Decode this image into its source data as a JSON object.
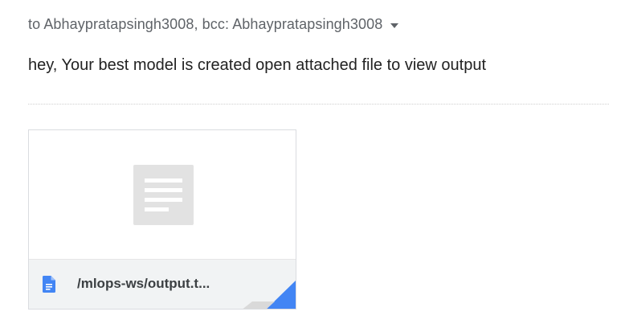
{
  "message": {
    "recipients_line": "to Abhaypratapsingh3008, bcc: Abhaypratapsingh3008",
    "details_toggle_icon": "caret-down-icon",
    "body": "hey, Your best model is created open attached file to view output"
  },
  "attachment": {
    "file_name": "/mlops-ws/output.t...",
    "preview_icon": "document-thumbnail-icon",
    "file_type_icon": "google-docs-file-icon"
  },
  "colors": {
    "recipients_text": "#5f6368",
    "body_text": "#222222",
    "attachment_border": "#dadce0",
    "attachment_footer": "#f1f3f4",
    "file_icon": "#4285f4",
    "thumbnail": "#e2e2e2"
  }
}
